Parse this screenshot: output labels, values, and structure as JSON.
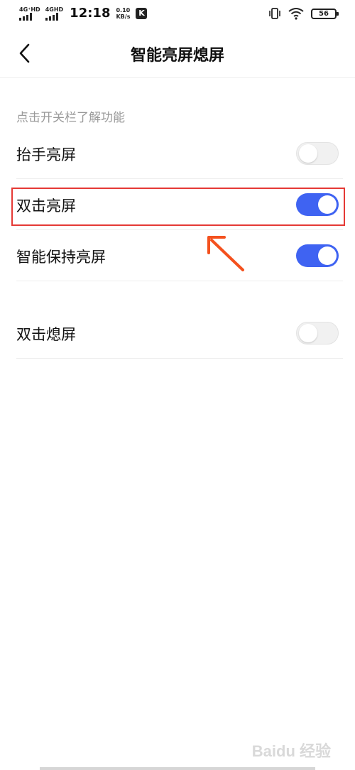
{
  "status_bar": {
    "network1": "4G⁺HD",
    "network2": "4GHD",
    "time": "12:18",
    "speed_value": "0.10",
    "speed_unit": "KB/s",
    "app_icon_letter": "K",
    "battery": "56",
    "icons": [
      "vibrate-icon",
      "wifi-icon",
      "battery-icon"
    ]
  },
  "header": {
    "title": "智能亮屏熄屏",
    "back_icon": "chevron-left-icon"
  },
  "hint": "点击开关栏了解功能",
  "settings": [
    {
      "label": "抬手亮屏",
      "enabled": false
    },
    {
      "label": "双击亮屏",
      "enabled": true
    },
    {
      "label": "智能保持亮屏",
      "enabled": true
    },
    {
      "label": "双击熄屏",
      "enabled": false
    }
  ],
  "annotation": {
    "highlight_color": "#e53935",
    "arrow_color": "#f4511e"
  },
  "watermark": "Baidu 经验",
  "colors": {
    "accent": "#3f63f2",
    "switch_off": "#f1f1f1"
  }
}
